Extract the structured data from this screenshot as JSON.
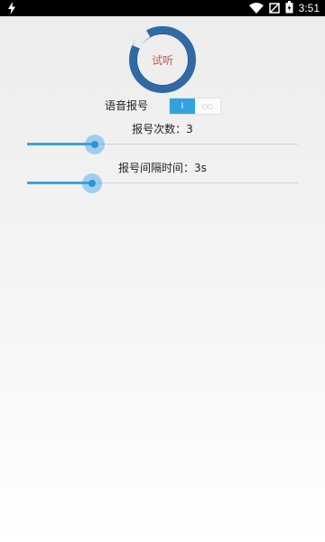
{
  "status_bar": {
    "time": "3:51",
    "icons": [
      "flash-icon",
      "wifi-icon",
      "no-sim-icon",
      "battery-icon"
    ]
  },
  "listen_button": {
    "label": "试听"
  },
  "voice_announce": {
    "label": "语音报号",
    "toggle_on_label": "I",
    "toggle_off_label": "○○",
    "enabled": true
  },
  "repeat_count": {
    "label": "报号次数：3",
    "fraction": 0.25
  },
  "interval": {
    "label": "报号间隔时间：3s",
    "fraction": 0.24
  },
  "colors": {
    "accent": "#33a3e0",
    "listen_text": "#c8584e",
    "ring": "#2f6aa5"
  }
}
